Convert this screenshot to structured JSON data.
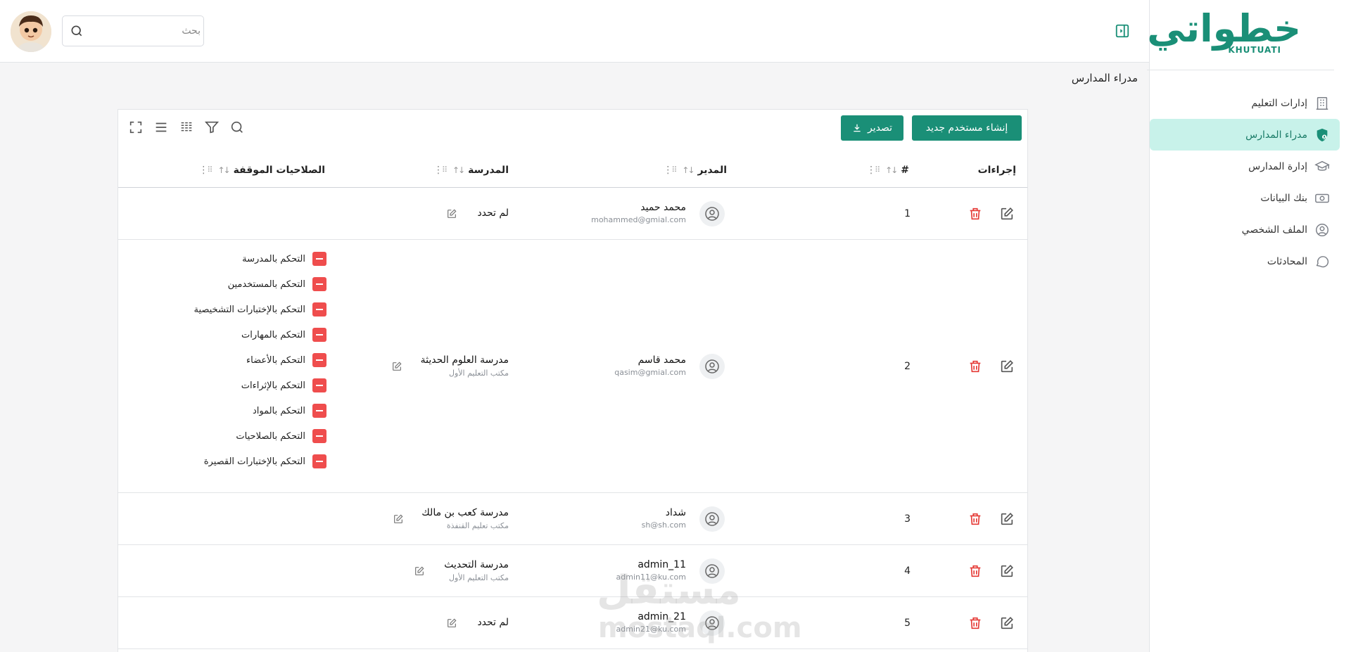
{
  "brand": {
    "logo_text": "خطواتي",
    "logo_sub": "KHUTUATI",
    "accent": "#1a8f77"
  },
  "sidebar": {
    "items": [
      {
        "label": "إدارات التعليم",
        "icon": "building-icon",
        "active": false
      },
      {
        "label": "مدراء المدارس",
        "icon": "shield-user-icon",
        "active": true
      },
      {
        "label": "إدارة المدارس",
        "icon": "graduation-cap-icon",
        "active": false
      },
      {
        "label": "بنك البيانات",
        "icon": "data-bank-icon",
        "active": false
      },
      {
        "label": "الملف الشخصي",
        "icon": "user-circle-icon",
        "active": false
      },
      {
        "label": "المحادثات",
        "icon": "chat-icon",
        "active": false
      }
    ]
  },
  "topbar": {
    "search_placeholder": "بحث"
  },
  "page": {
    "title": "مدراء المدارس"
  },
  "toolbar": {
    "new_user_label": "إنشاء مستخدم جديد",
    "export_label": "تصدير"
  },
  "table": {
    "headers": {
      "actions": "إجراءات",
      "number": "#",
      "manager": "المدير",
      "school": "المدرسة",
      "permissions": "الصلاحيات الموقفة"
    },
    "rows": [
      {
        "number": "1",
        "manager_name": "محمد حميد",
        "manager_email": "mohammed@gmial.com",
        "school_name": "لم تحدد",
        "school_office": "",
        "permissions": []
      },
      {
        "number": "2",
        "manager_name": "محمد قاسم",
        "manager_email": "qasim@gmial.com",
        "school_name": "مدرسة العلوم الحديثة",
        "school_office": "مكتب التعليم الأول",
        "permissions": [
          "التحكم بالمدرسة",
          "التحكم بالمستخدمين",
          "التحكم بالإختبارات التشخيصية",
          "التحكم بالمهارات",
          "التحكم بالأعضاء",
          "التحكم بالإثراءات",
          "التحكم بالمواد",
          "التحكم بالصلاحيات",
          "التحكم بالإختبارات القصيرة"
        ]
      },
      {
        "number": "3",
        "manager_name": "شداد",
        "manager_email": "sh@sh.com",
        "school_name": "مدرسة كعب بن مالك",
        "school_office": "مكتب تعليم القنفذة",
        "permissions": []
      },
      {
        "number": "4",
        "manager_name": "admin_11",
        "manager_email": "admin11@ku.com",
        "school_name": "مدرسة التحديث",
        "school_office": "مكتب التعليم الأول",
        "permissions": []
      },
      {
        "number": "5",
        "manager_name": "admin_21",
        "manager_email": "admin21@ku.com",
        "school_name": "لم تحدد",
        "school_office": "",
        "permissions": []
      }
    ]
  },
  "watermark": {
    "text": "مستقل",
    "sub": "mostaql.com"
  }
}
